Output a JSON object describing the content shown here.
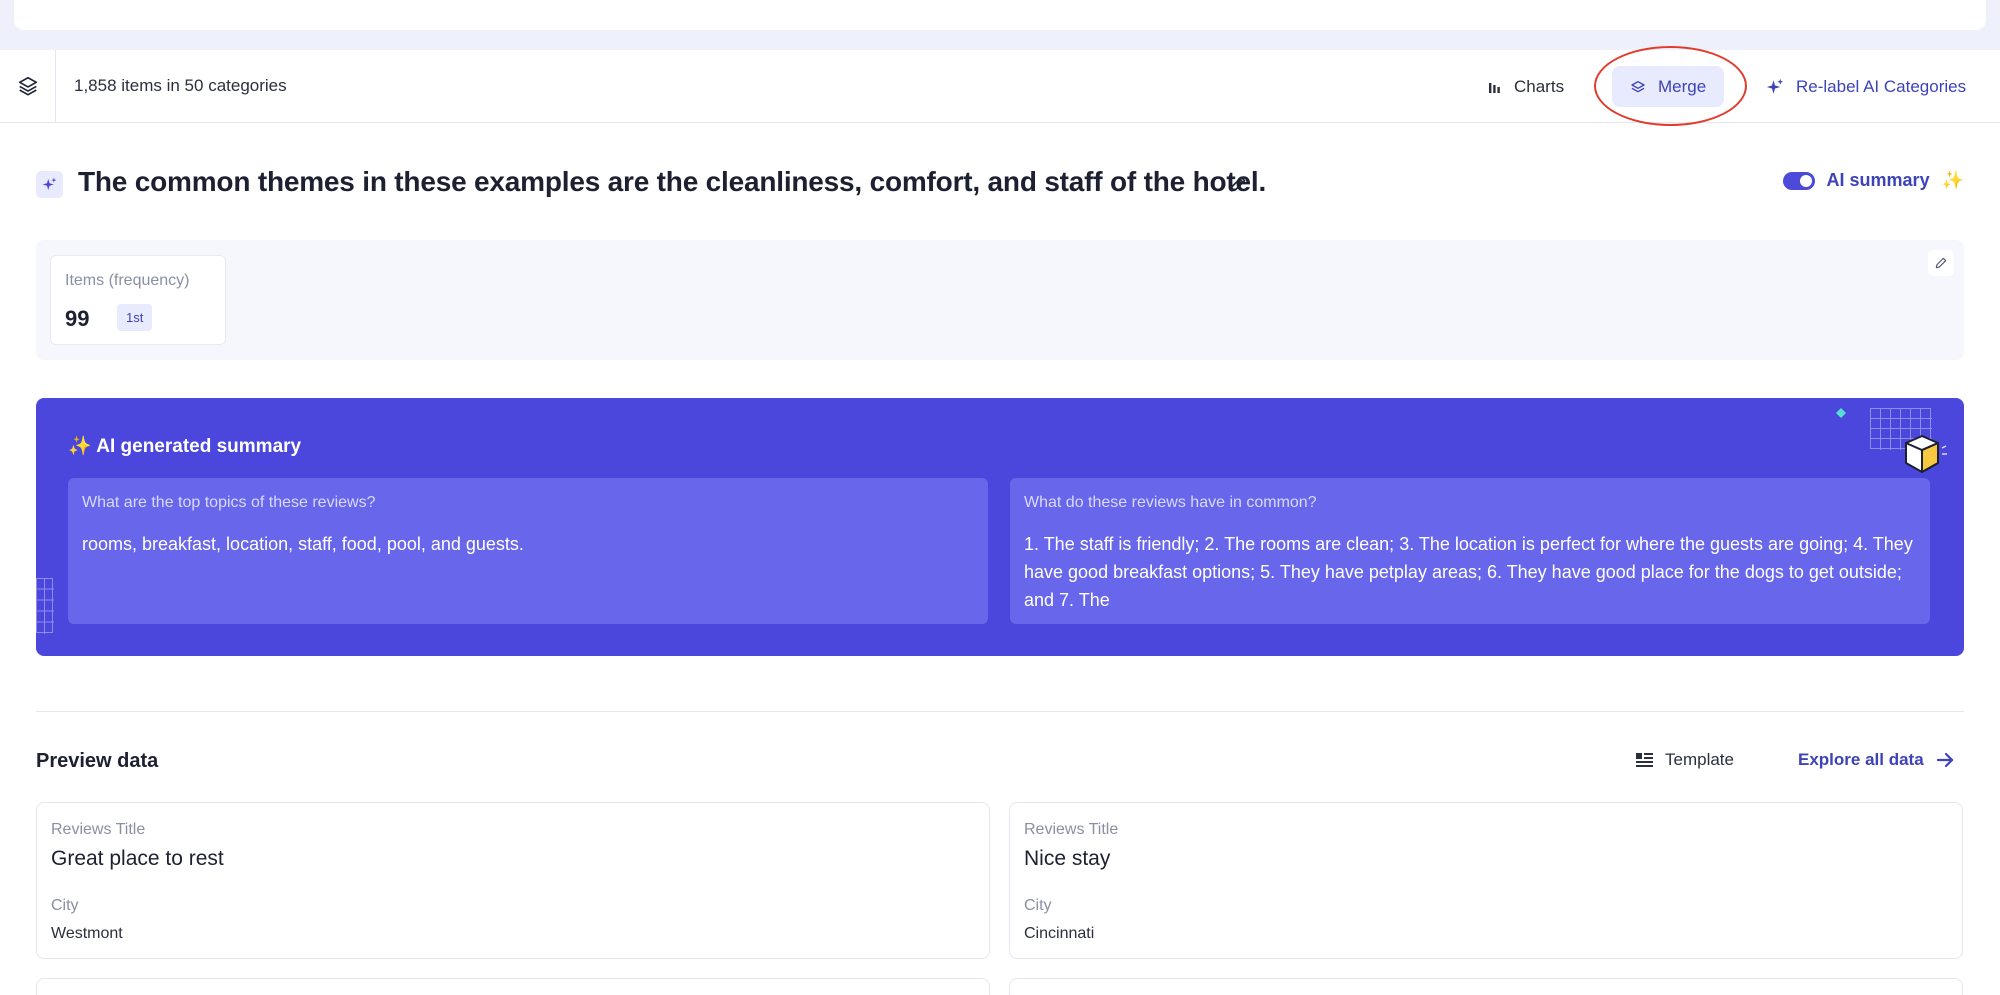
{
  "toolbar": {
    "count_text": "1,858 items in 50 categories",
    "charts_label": "Charts",
    "merge_label": "Merge",
    "relabel_label": "Re-label AI Categories"
  },
  "category": {
    "title": "The common themes in these examples are the cleanliness, comfort, and staff of the hotel.",
    "ai_summary_label": "AI summary",
    "ai_summary_enabled": true
  },
  "stats": {
    "label": "Items (frequency)",
    "value": "99",
    "rank": "1st"
  },
  "ai_summary": {
    "heading": "AI generated summary",
    "questions": [
      {
        "question": "What are the top topics of these reviews?",
        "answer": "rooms, breakfast, location, staff, food, pool, and guests."
      },
      {
        "question": "What do these reviews have in common?",
        "answer": "1. The staff is friendly; 2. The rooms are clean; 3. The location is perfect for where the guests are going; 4. They have good breakfast options; 5. They have petplay areas; 6. They have good place for the dogs to get outside; and 7. The"
      }
    ]
  },
  "preview": {
    "title": "Preview data",
    "template_label": "Template",
    "explore_label": "Explore all data",
    "cards": [
      {
        "title_label": "Reviews Title",
        "title": "Great place to rest",
        "city_label": "City",
        "city": "Westmont"
      },
      {
        "title_label": "Reviews Title",
        "title": "Nice stay",
        "city_label": "City",
        "city": "Cincinnati"
      }
    ]
  },
  "colors": {
    "accent": "#4c47dc",
    "accent_text": "#3d43b8",
    "annotation": "#e23b2c"
  },
  "icons": {
    "layers": "layers-icon",
    "charts": "bar-chart-icon",
    "merge": "layers-icon",
    "relabel": "sparkle-icon",
    "edit": "pencil-icon",
    "template": "template-icon",
    "explore": "arrow-right-icon"
  }
}
